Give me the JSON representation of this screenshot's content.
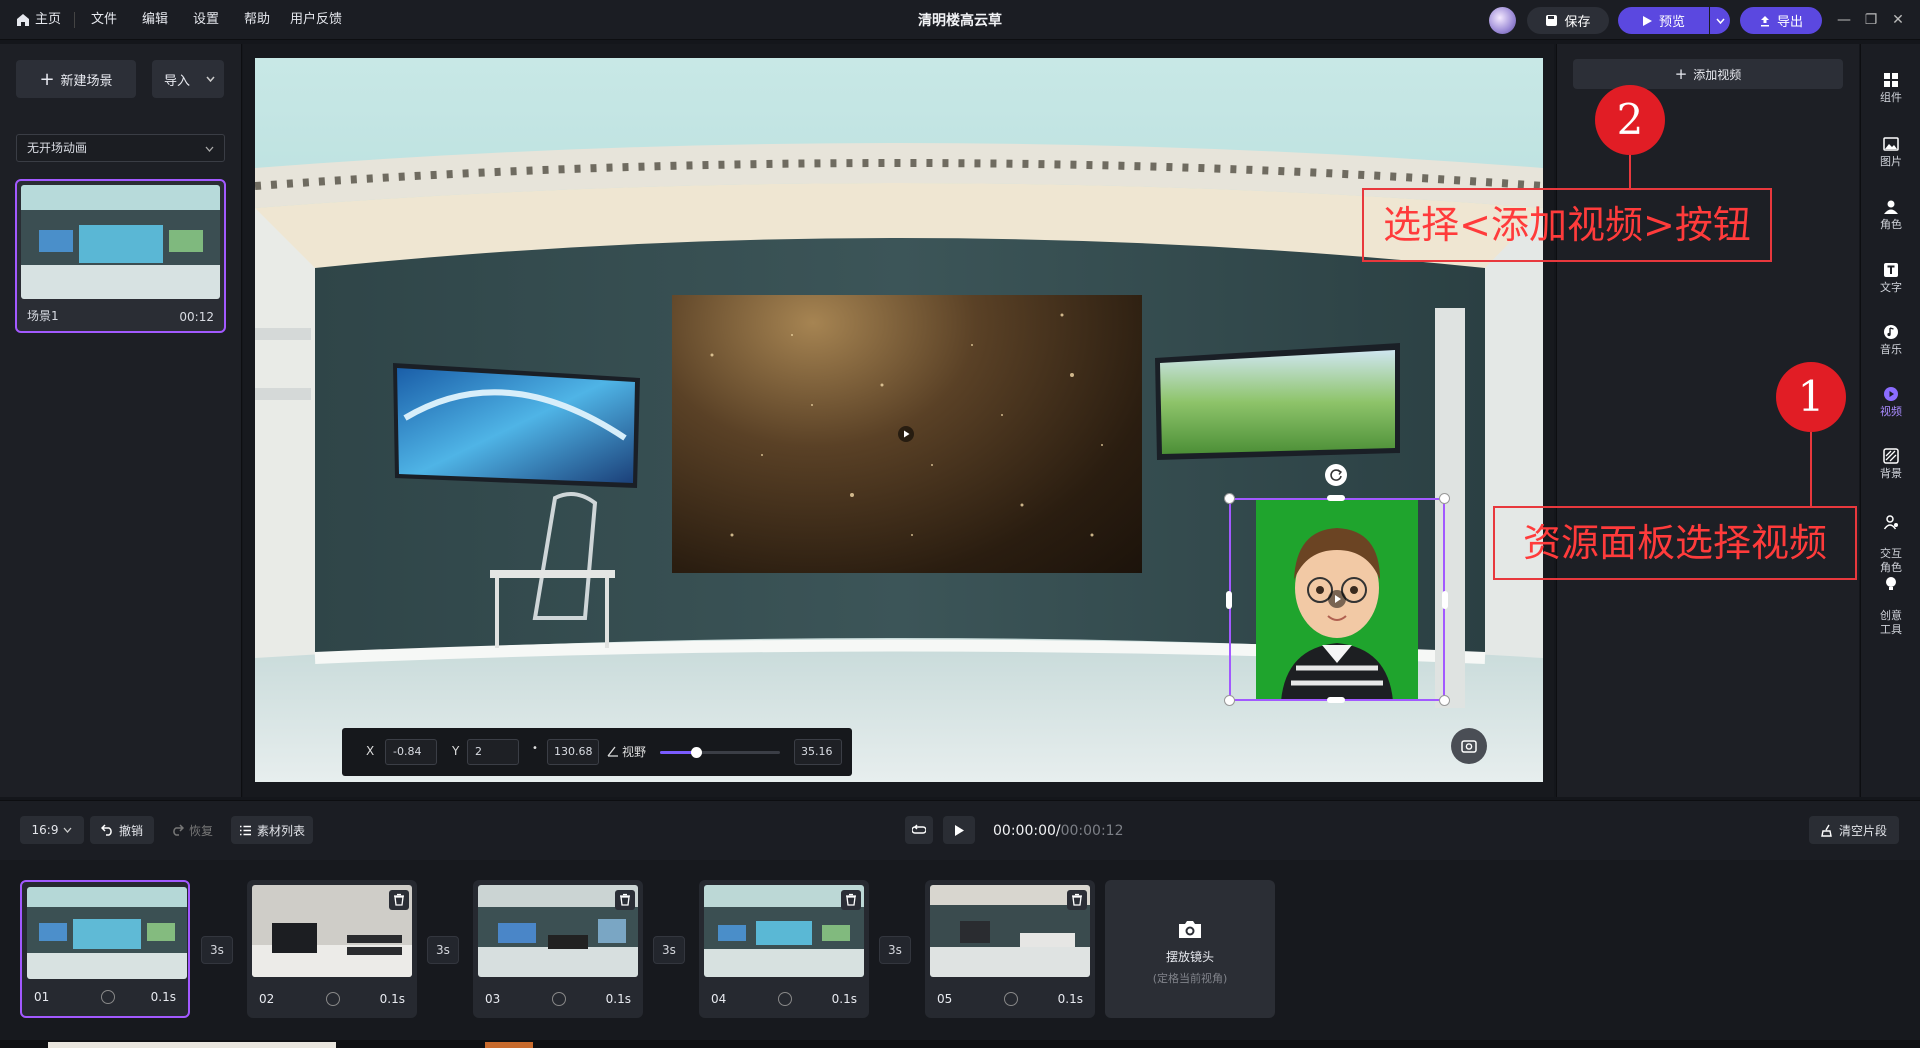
{
  "menu": {
    "home": "主页",
    "items": [
      "文件",
      "编辑",
      "设置",
      "帮助",
      "用户反馈"
    ]
  },
  "title": "清明楼高云草",
  "top_actions": {
    "save": "保存",
    "preview": "预览",
    "export": "导出"
  },
  "left": {
    "new_scene": "新建场景",
    "import": "导入",
    "scene_anim": "无开场动画",
    "scene": {
      "name": "场景1",
      "duration": "00:12"
    }
  },
  "coords": {
    "x_label": "X",
    "x": "-0.84",
    "y_label": "Y",
    "y": "2",
    "z_dot": "•",
    "z": "130.68",
    "fov_label": "视野",
    "fov": "35.16",
    "fov_level": 0.3
  },
  "right": {
    "add_video": "添加视频"
  },
  "sidebar": {
    "items": [
      {
        "label": "组件",
        "icon": "grid-icon"
      },
      {
        "label": "图片",
        "icon": "image-icon"
      },
      {
        "label": "角色",
        "icon": "person-icon"
      },
      {
        "label": "文字",
        "icon": "text-icon"
      },
      {
        "label": "音乐",
        "icon": "music-icon"
      },
      {
        "label": "视频",
        "icon": "video-icon",
        "active": true
      },
      {
        "label": "背景",
        "icon": "background-icon"
      },
      {
        "label": "交互\n角色",
        "icon": "interactive-person-icon"
      },
      {
        "label": "创意\n工具",
        "icon": "bulb-icon"
      }
    ]
  },
  "toolbar": {
    "ratio": "16:9",
    "undo": "撤销",
    "redo": "恢复",
    "assets": "素材列表",
    "time_current": "00:00:00/",
    "time_total": "00:00:12",
    "clear": "清空片段"
  },
  "timeline": {
    "shots": [
      {
        "label": "01",
        "dur": "0.1s"
      },
      {
        "label": "02",
        "dur": "0.1s"
      },
      {
        "label": "03",
        "dur": "0.1s"
      },
      {
        "label": "04",
        "dur": "0.1s"
      },
      {
        "label": "05",
        "dur": "0.1s"
      }
    ],
    "transitions": [
      "3s",
      "3s",
      "3s",
      "3s"
    ],
    "place_camera": "摆放镜头",
    "place_camera_sub": "(定格当前视角)"
  },
  "annotations": {
    "n1": "1",
    "t1": "资源面板选择视频",
    "n2": "2",
    "t2": "选择<添加视频>按钮"
  },
  "colors": {
    "accent": "#6c4de6",
    "selection": "#a259ff",
    "annotation": "#e8383d"
  }
}
